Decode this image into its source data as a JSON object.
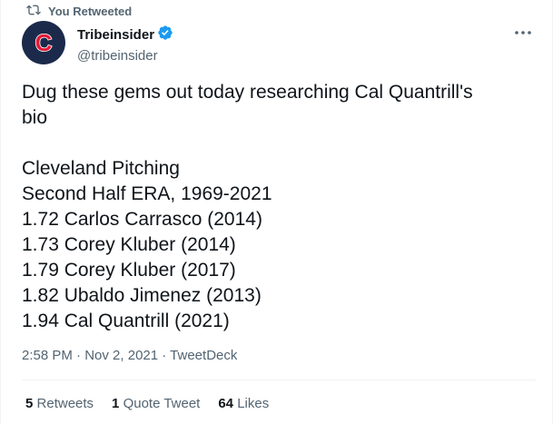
{
  "retweet_context": {
    "label": "You Retweeted",
    "icon": "retweet-icon"
  },
  "author": {
    "display_name": "Tribeinsider",
    "handle": "@tribeinsider",
    "avatar_letter": "C",
    "avatar_bg": "#1b2a4a",
    "avatar_accent": "#e31937",
    "verified": true
  },
  "tweet": {
    "lines": [
      "Dug these gems out today researching Cal Quantrill's",
      "bio",
      "",
      "Cleveland Pitching",
      "Second Half ERA, 1969-2021",
      "1.72 Carlos Carrasco (2014)",
      "1.73 Corey Kluber (2014)",
      "1.79 Corey Kluber (2017)",
      "1.82 Ubaldo Jimenez (2013)",
      "1.94 Cal Quantrill (2021)"
    ]
  },
  "meta": {
    "time": "2:58 PM",
    "date": "Nov 2, 2021",
    "source": "TweetDeck",
    "separator": " · "
  },
  "stats": {
    "retweets_count": "5",
    "retweets_label": "Retweets",
    "quotes_count": "1",
    "quotes_label": "Quote Tweet",
    "likes_count": "64",
    "likes_label": "Likes"
  },
  "colors": {
    "text": "#0f1419",
    "muted": "#536471",
    "verified": "#1d9bf0",
    "border": "#eff3f4"
  }
}
